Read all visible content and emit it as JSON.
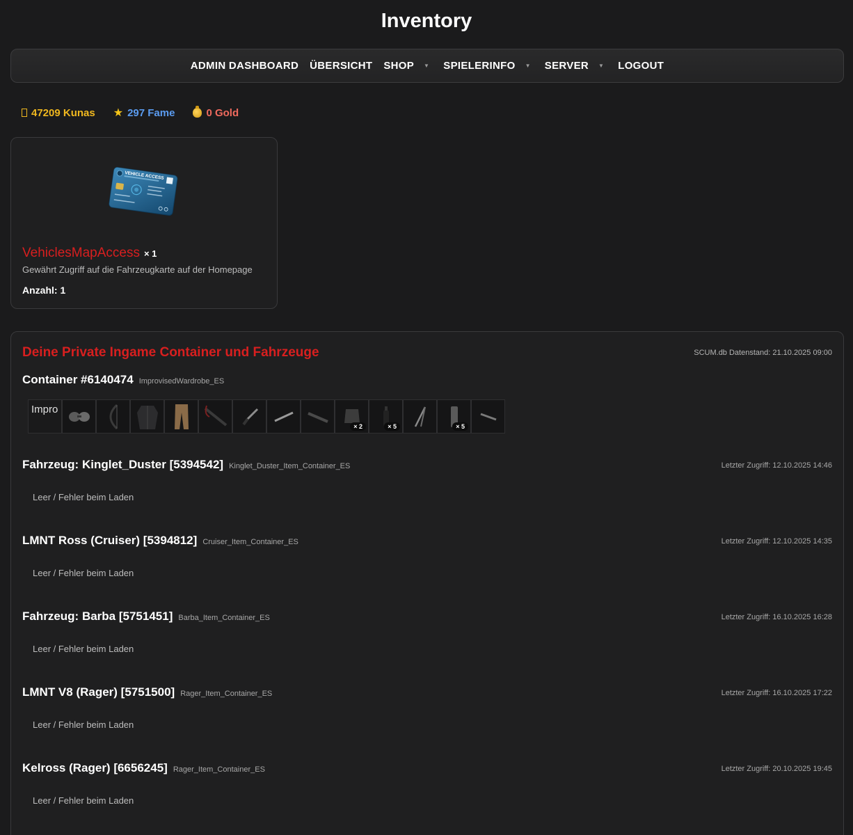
{
  "page": {
    "title": "Inventory"
  },
  "nav": {
    "items": [
      {
        "label": "ADMIN DASHBOARD",
        "dropdown": false
      },
      {
        "label": "ÜBERSICHT",
        "dropdown": false
      },
      {
        "label": "SHOP",
        "dropdown": true
      },
      {
        "label": "SPIELERINFO",
        "dropdown": true
      },
      {
        "label": "SERVER",
        "dropdown": true
      },
      {
        "label": "LOGOUT",
        "dropdown": false
      }
    ]
  },
  "stats": {
    "kunas": "47209 Kunas",
    "fame": "297 Fame",
    "gold": "0 Gold",
    "colors": {
      "kunas": "#f0b81f",
      "fame": "#5b9cf0",
      "gold": "#f06a5e"
    }
  },
  "item_card": {
    "image": "vehicle-access-card",
    "image_text": "VEHICLE ACCESS",
    "name": "VehiclesMapAccess",
    "qty_inline": "× 1",
    "description": "Gewährt Zugriff auf die Fahrzeugkarte auf der Homepage",
    "count": "Anzahl: 1"
  },
  "containers": {
    "title": "Deine Private Ingame Container und Fahrzeuge",
    "stamp": "SCUM.db Datenstand: 21.10.2025 09:00",
    "container": {
      "name": "Container #6140474",
      "code": "ImprovisedWardrobe_ES",
      "slots": [
        {
          "icon": "broken-image",
          "alt": "Impro"
        },
        {
          "icon": "goggles-icon",
          "badge": ""
        },
        {
          "icon": "bow-icon",
          "badge": ""
        },
        {
          "icon": "jacket-icon",
          "badge": ""
        },
        {
          "icon": "pants-icon",
          "badge": ""
        },
        {
          "icon": "crossbow-icon",
          "badge": ""
        },
        {
          "icon": "knife-icon",
          "badge": ""
        },
        {
          "icon": "rod-icon",
          "badge": ""
        },
        {
          "icon": "rifle-icon",
          "badge": ""
        },
        {
          "icon": "vest-icon",
          "badge": "× 2"
        },
        {
          "icon": "bottle-icon",
          "badge": "× 5"
        },
        {
          "icon": "tripod-icon",
          "badge": ""
        },
        {
          "icon": "magazine-icon",
          "badge": "× 5"
        },
        {
          "icon": "bar-icon",
          "badge": ""
        }
      ]
    },
    "vehicles": [
      {
        "name": "Fahrzeug: Kinglet_Duster [5394542]",
        "code": "Kinglet_Duster_Item_Container_ES",
        "access": "Letzter Zugriff: 12.10.2025 14:46",
        "status": "Leer / Fehler beim Laden"
      },
      {
        "name": "LMNT Ross (Cruiser) [5394812]",
        "code": "Cruiser_Item_Container_ES",
        "access": "Letzter Zugriff: 12.10.2025 14:35",
        "status": "Leer / Fehler beim Laden"
      },
      {
        "name": "Fahrzeug: Barba [5751451]",
        "code": "Barba_Item_Container_ES",
        "access": "Letzter Zugriff: 16.10.2025 16:28",
        "status": "Leer / Fehler beim Laden"
      },
      {
        "name": "LMNT V8 (Rager) [5751500]",
        "code": "Rager_Item_Container_ES",
        "access": "Letzter Zugriff: 16.10.2025 17:22",
        "status": "Leer / Fehler beim Laden"
      },
      {
        "name": "Kelross (Rager) [6656245]",
        "code": "Rager_Item_Container_ES",
        "access": "Letzter Zugriff: 20.10.2025 19:45",
        "status": "Leer / Fehler beim Laden"
      }
    ]
  }
}
